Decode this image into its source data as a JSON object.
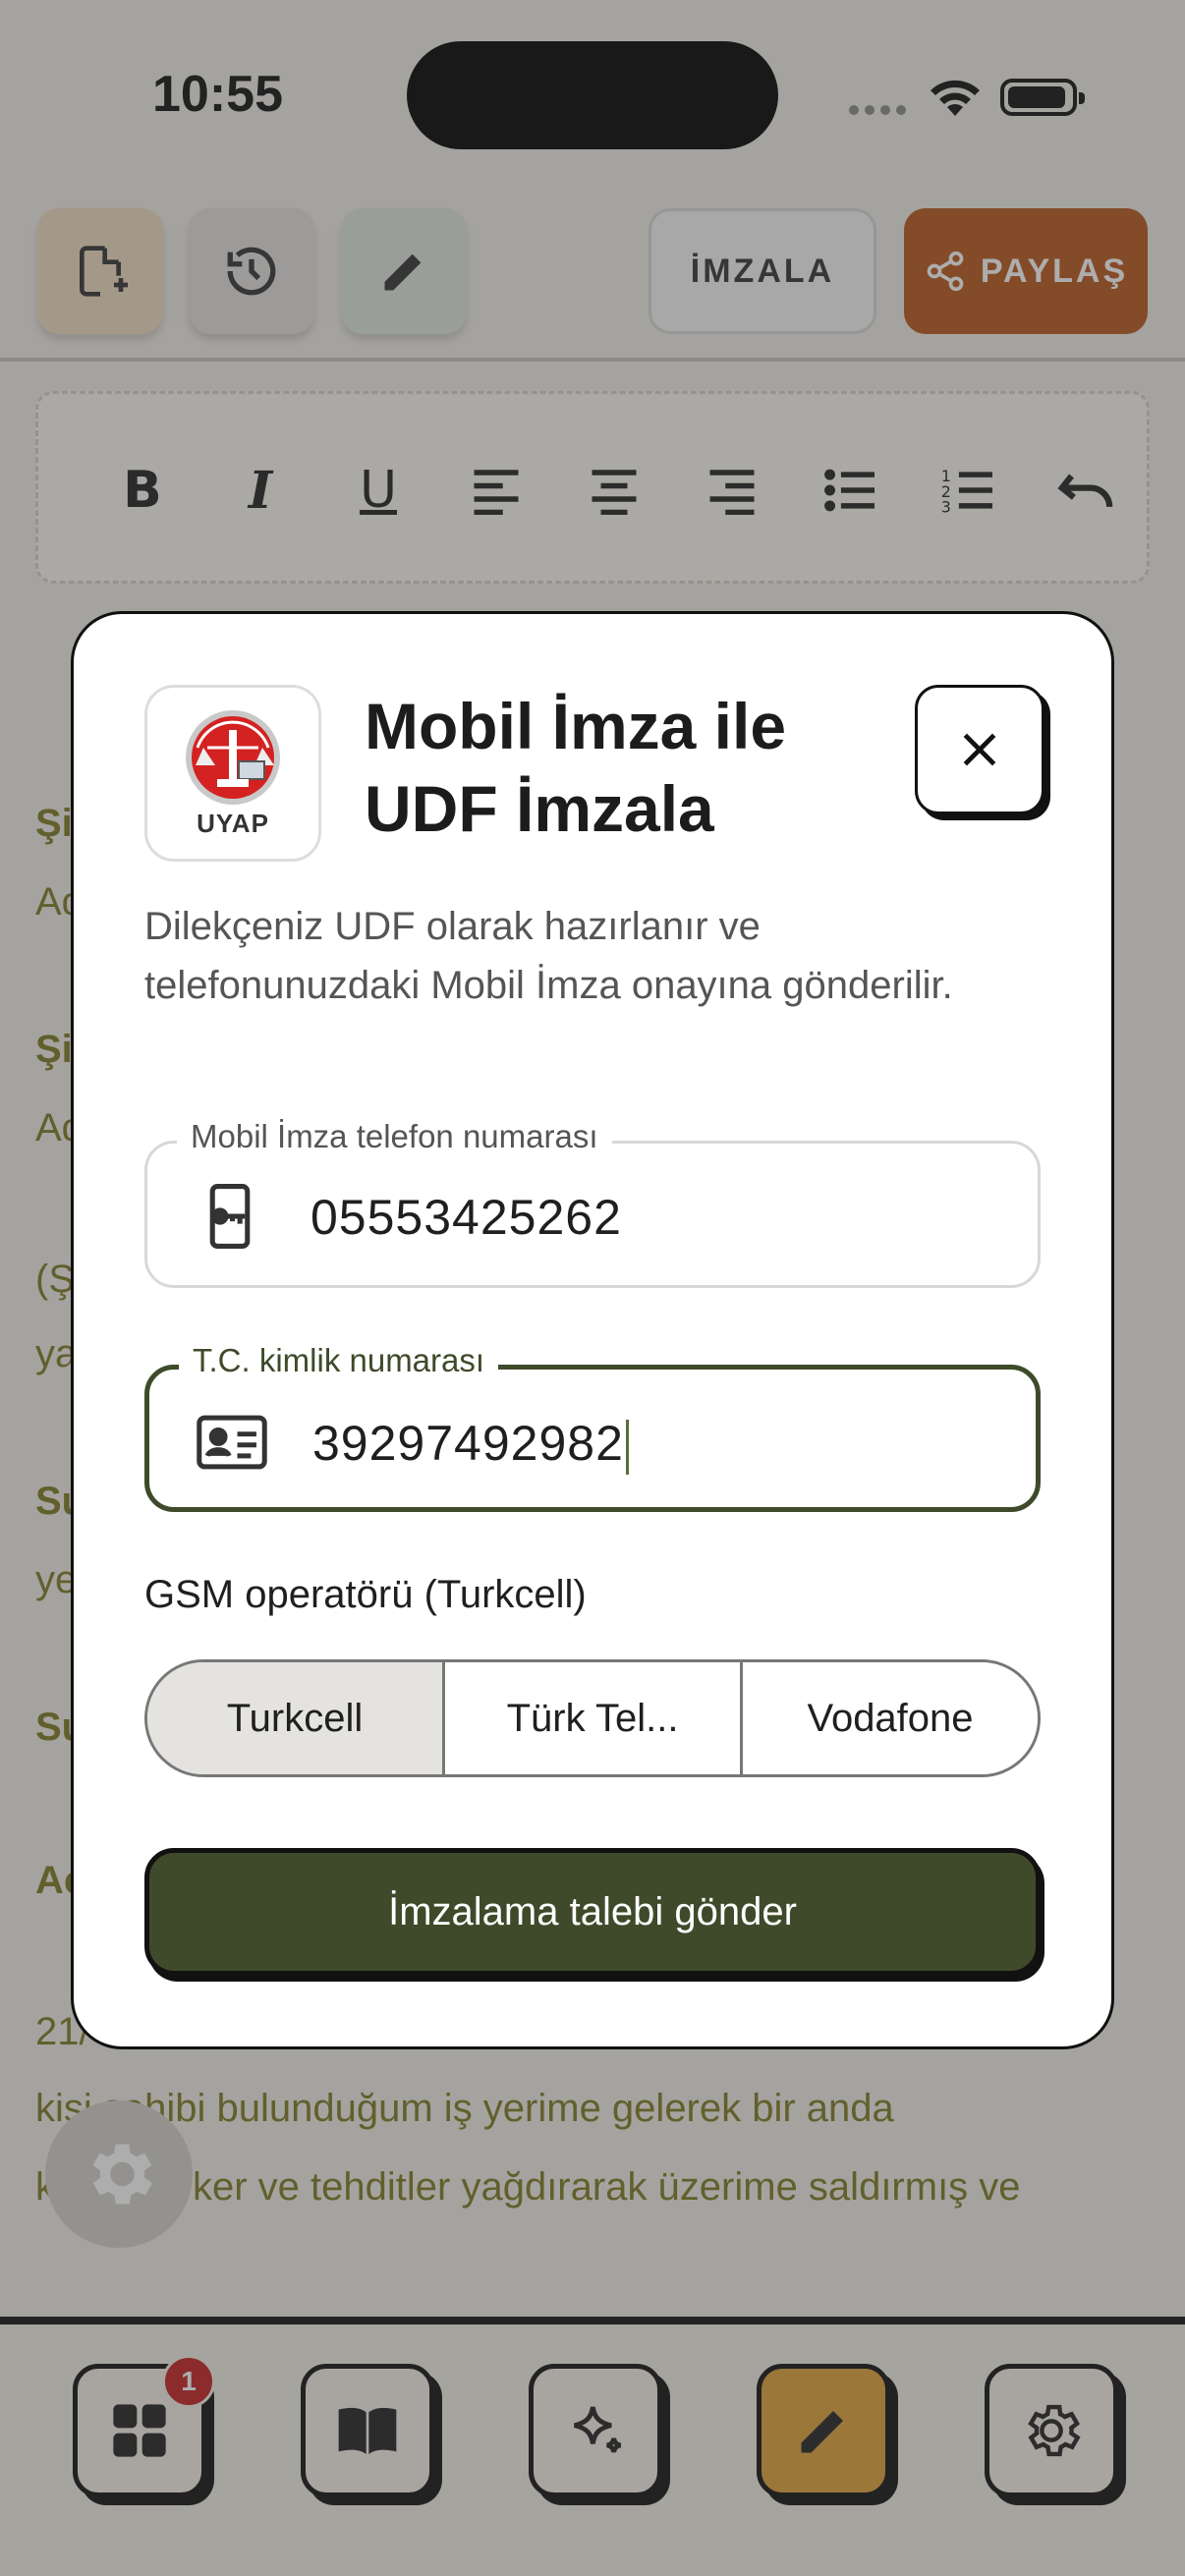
{
  "status_bar": {
    "time": "10:55"
  },
  "toolbar": {
    "sign_label": "İMZALA",
    "share_label": "PAYLAŞ"
  },
  "document": {
    "lines": [
      {
        "text": "Şi",
        "bold": true
      },
      {
        "text": "Ad",
        "bold": false
      },
      {
        "text": "Şi",
        "bold": true
      },
      {
        "text": "Ad",
        "bold": false
      },
      {
        "text": "(Ş",
        "bold": false
      },
      {
        "text": "ya",
        "bold": false
      },
      {
        "text": "Su",
        "bold": true
      },
      {
        "text": "ye",
        "bold": false
      },
      {
        "text": "Su",
        "bold": true
      },
      {
        "text": "Ac",
        "bold": true
      },
      {
        "text": "21/",
        "bold": false
      }
    ],
    "full_line_1": "kişi sahibi bulunduğum iş yerime gelerek bir anda",
    "full_line_2_a": "kü",
    "full_line_2_b": "ker ve tehditler yağdırarak üzerime saldırmış ve"
  },
  "bottom_nav": {
    "badge_count": "1"
  },
  "modal": {
    "logo_text": "UYAP",
    "title": "Mobil İmza ile UDF İmzala",
    "description": "Dilekçeniz UDF olarak hazırlanır ve telefonunuzdaki Mobil İmza onayına gönderilir.",
    "phone_field": {
      "label": "Mobil İmza telefon numarası",
      "value": "05553425262"
    },
    "tc_field": {
      "label": "T.C. kimlik numarası",
      "value": "39297492982"
    },
    "gsm_label": "GSM operatörü (Turkcell)",
    "operators": [
      {
        "label": "Turkcell",
        "selected": true
      },
      {
        "label": "Türk Tel...",
        "selected": false
      },
      {
        "label": "Vodafone",
        "selected": false
      }
    ],
    "submit_label": "İmzalama talebi gönder"
  },
  "colors": {
    "accent_green": "#3f4a2a",
    "share_orange": "#b8561a",
    "active_nav": "#e0a23a",
    "doc_text": "#7c7a24",
    "badge_red": "#c41f1f"
  }
}
